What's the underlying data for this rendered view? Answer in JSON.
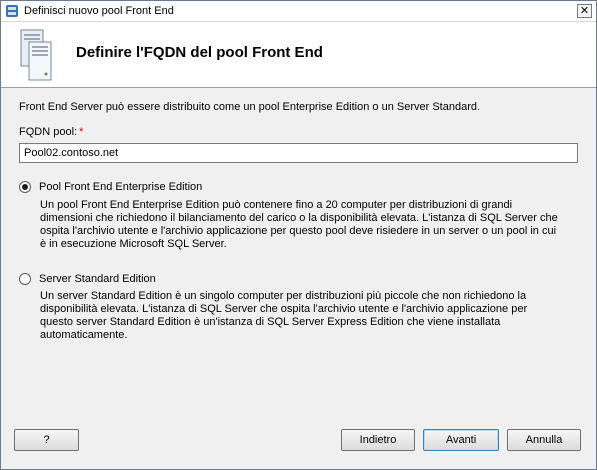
{
  "window": {
    "title": "Definisci nuovo pool Front End",
    "close_glyph": "✕"
  },
  "header": {
    "title": "Definire l'FQDN del pool Front End",
    "icon": "server-stack-icon"
  },
  "form": {
    "intro": "Front End Server può essere distribuito come un pool Enterprise Edition o un Server Standard.",
    "fqdn_label": "FQDN pool:",
    "required_marker": "*",
    "fqdn_value": "Pool02.contoso.net"
  },
  "options": [
    {
      "label": "Pool Front End Enterprise Edition",
      "selected": true,
      "description": "Un pool Front End Enterprise Edition può contenere fino a 20 computer per distribuzioni di grandi dimensioni che richiedono il bilanciamento del carico o la disponibilità elevata. L'istanza di SQL Server che ospita l'archivio utente e l'archivio applicazione per questo pool deve risiedere in un server o un pool in cui è in esecuzione Microsoft SQL Server."
    },
    {
      "label": "Server Standard Edition",
      "selected": false,
      "description": "Un server Standard Edition è un singolo computer per distribuzioni più piccole che non richiedono la disponibilità elevata. L'istanza di SQL Server che ospita l'archivio utente e l'archivio applicazione per questo server Standard Edition è un'istanza di SQL Server Express Edition che viene installata automaticamente."
    }
  ],
  "buttons": {
    "help": "?",
    "back": "Indietro",
    "next": "Avanti",
    "cancel": "Annulla"
  }
}
